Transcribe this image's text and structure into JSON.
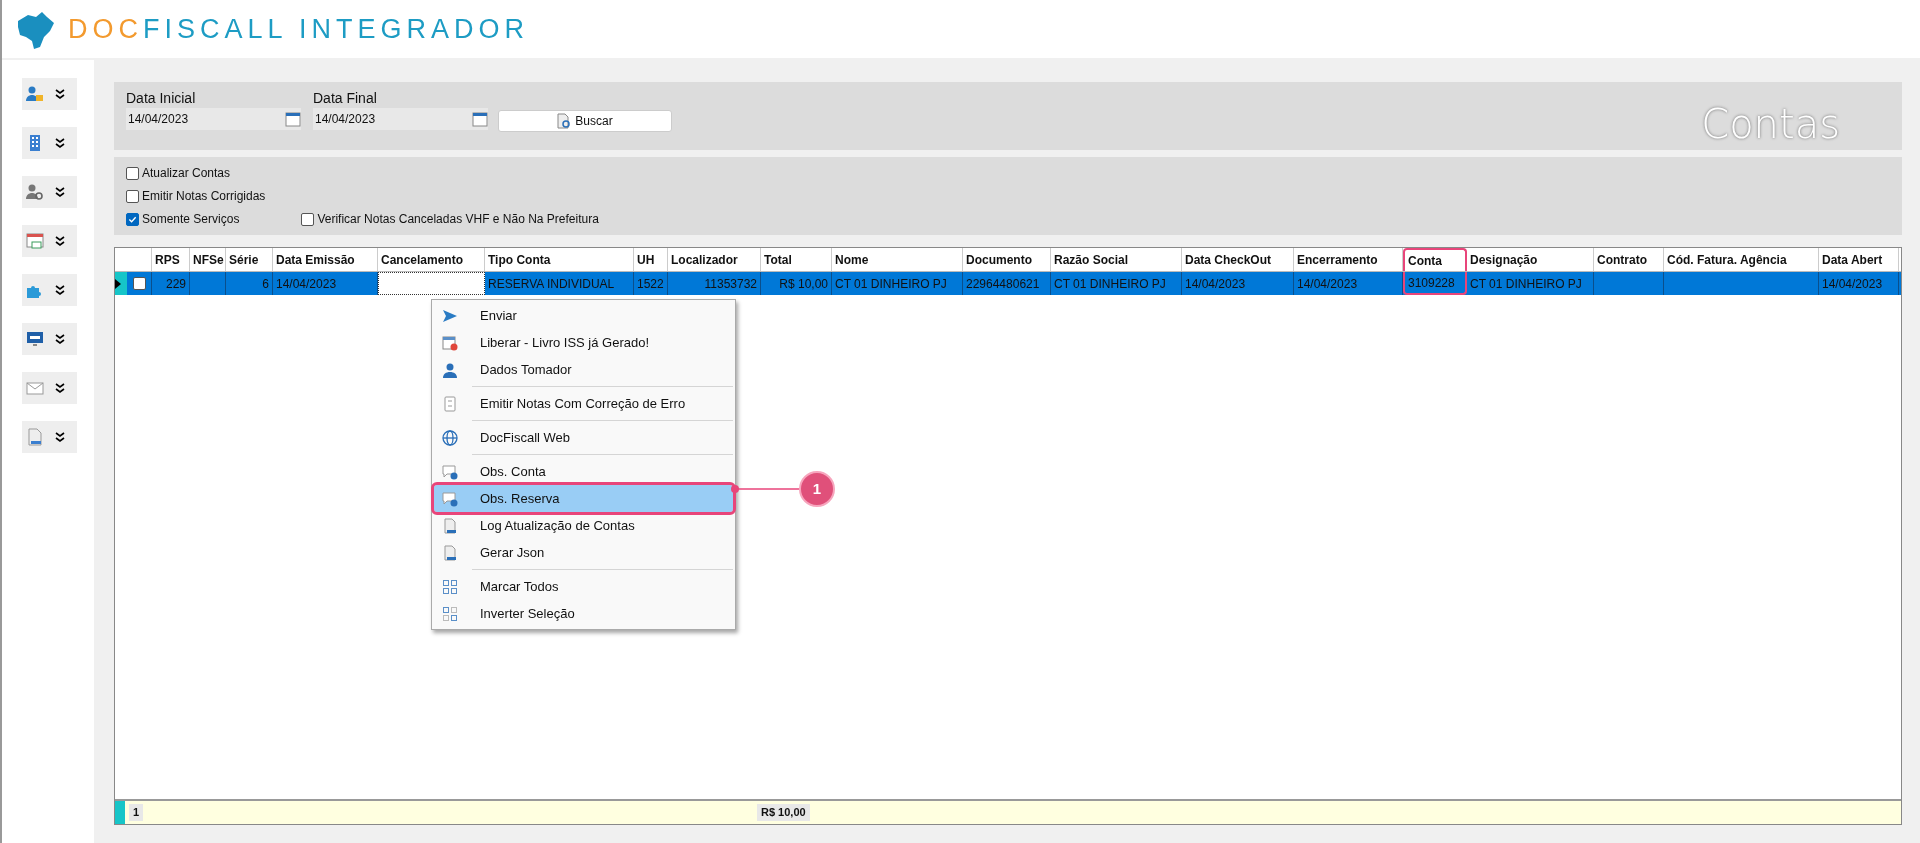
{
  "logo": {
    "parts": [
      {
        "text": "DOC",
        "color": "#f39a2e"
      },
      {
        "text": "FISCALL INTEGRADOR",
        "color": "#1d9cc4"
      }
    ]
  },
  "sidebar": {
    "items": [
      {
        "kind": "users"
      },
      {
        "kind": "building"
      },
      {
        "kind": "user-gear"
      },
      {
        "kind": "window-money"
      },
      {
        "kind": "puzzle"
      },
      {
        "kind": "monitor"
      },
      {
        "kind": "mail"
      },
      {
        "kind": "file"
      }
    ]
  },
  "filters": {
    "start_label": "Data Inicial",
    "start_value": "14/04/2023",
    "end_label": "Data Final",
    "end_value": "14/04/2023",
    "search_button": "Buscar",
    "page_title": "Contas"
  },
  "options": [
    {
      "label": "Atualizar Contas",
      "checked": false
    },
    {
      "label": "Emitir Notas Corrigidas",
      "checked": false
    },
    {
      "label": "Somente Serviços",
      "checked": true
    },
    {
      "label": "Verificar Notas Canceladas VHF e Não Na Prefeitura",
      "checked": false
    }
  ],
  "table": {
    "columns": [
      {
        "label": "RPS",
        "highlighted": false
      },
      {
        "label": "NFSe",
        "highlighted": false
      },
      {
        "label": "Série",
        "highlighted": false
      },
      {
        "label": "Data Emissão",
        "highlighted": false
      },
      {
        "label": "Cancelamento",
        "highlighted": false
      },
      {
        "label": "Tipo Conta",
        "highlighted": false
      },
      {
        "label": "UH",
        "highlighted": false
      },
      {
        "label": "Localizador",
        "highlighted": false
      },
      {
        "label": "Total",
        "highlighted": false
      },
      {
        "label": "Nome",
        "highlighted": false
      },
      {
        "label": "Documento",
        "highlighted": false
      },
      {
        "label": "Razão Social",
        "highlighted": false
      },
      {
        "label": "Data CheckOut",
        "highlighted": false
      },
      {
        "label": "Encerramento",
        "highlighted": false
      },
      {
        "label": "Conta",
        "highlighted": true
      },
      {
        "label": "Designação",
        "highlighted": false
      },
      {
        "label": "Contrato",
        "highlighted": false
      },
      {
        "label": "Cód. Fatura. Agência",
        "highlighted": false
      },
      {
        "label": "Data Abert",
        "highlighted": false
      }
    ],
    "rows": [
      {
        "selected": true,
        "checked": false,
        "cells": [
          "229",
          "",
          "6",
          "14/04/2023",
          "",
          "RESERVA INDIVIDUAL",
          "1522",
          "11353732",
          "R$ 10,00",
          "CT 01 DINHEIRO PJ",
          "22964480621",
          "CT 01 DINHEIRO PJ",
          "14/04/2023",
          "14/04/2023",
          "3109228",
          "CT 01 DINHEIRO PJ",
          "",
          "",
          "14/04/2023"
        ]
      }
    ],
    "footer": {
      "count": "1",
      "total": "R$ 10,00"
    }
  },
  "context_menu": {
    "groups": [
      [
        {
          "label": "Enviar",
          "kind": "send",
          "selected": false
        },
        {
          "label": "Liberar - Livro ISS já Gerado!",
          "kind": "release",
          "selected": false
        },
        {
          "label": "Dados Tomador",
          "kind": "person",
          "selected": false
        }
      ],
      [
        {
          "label": "Emitir Notas Com Correção de Erro",
          "kind": "document",
          "selected": false
        }
      ],
      [
        {
          "label": "DocFiscall Web",
          "kind": "globe",
          "selected": false
        }
      ],
      [
        {
          "label": "Obs. Conta",
          "kind": "comment",
          "selected": false
        },
        {
          "label": "Obs. Reserva",
          "kind": "comment",
          "selected": true
        },
        {
          "label": "Log Atualização de Contas",
          "kind": "log",
          "selected": false
        },
        {
          "label": "Gerar Json",
          "kind": "log",
          "selected": false
        }
      ],
      [
        {
          "label": "Marcar Todos",
          "kind": "grid",
          "selected": false
        },
        {
          "label": "Inverter Seleção",
          "kind": "invert",
          "selected": false
        }
      ]
    ],
    "callout": "1"
  }
}
